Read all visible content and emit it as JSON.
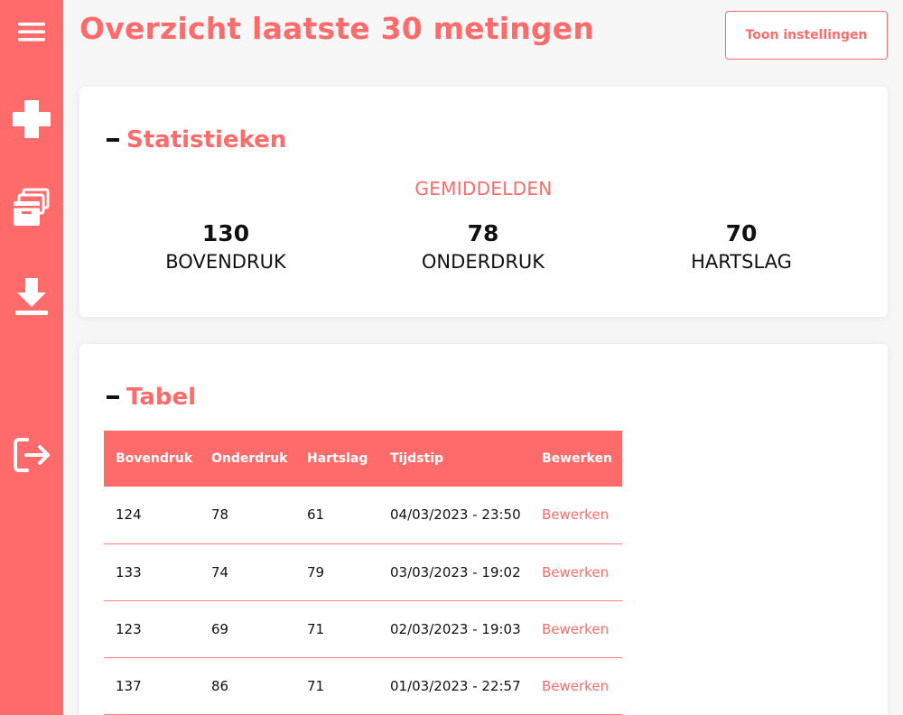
{
  "sidebar": {
    "icons": [
      "menu-icon",
      "plus-icon",
      "archive-icon",
      "download-icon",
      "logout-icon"
    ],
    "color": "#ff6b6b"
  },
  "header": {
    "title": "Overzicht laatste 30 metingen",
    "settings_button": "Toon instellingen"
  },
  "stats": {
    "heading": "Statistieken",
    "caption": "GEMIDDELDEN",
    "items": [
      {
        "value": "130",
        "label": "BOVENDRUK"
      },
      {
        "value": "78",
        "label": "ONDERDRUK"
      },
      {
        "value": "70",
        "label": "HARTSLAG"
      }
    ]
  },
  "table": {
    "heading": "Tabel",
    "columns": [
      "Bovendruk",
      "Onderdruk",
      "Hartslag",
      "Tijdstip",
      "Bewerken"
    ],
    "rows": [
      {
        "systolic": "124",
        "diastolic": "78",
        "pulse": "61",
        "time": "04/03/2023 - 23:50",
        "edit": "Bewerken"
      },
      {
        "systolic": "133",
        "diastolic": "74",
        "pulse": "79",
        "time": "03/03/2023 - 19:02",
        "edit": "Bewerken"
      },
      {
        "systolic": "123",
        "diastolic": "69",
        "pulse": "71",
        "time": "02/03/2023 - 19:03",
        "edit": "Bewerken"
      },
      {
        "systolic": "137",
        "diastolic": "86",
        "pulse": "71",
        "time": "01/03/2023 - 22:57",
        "edit": "Bewerken"
      }
    ]
  },
  "colors": {
    "accent": "#ff6b6b",
    "text": "#111111",
    "background": "#f7f7f7"
  }
}
